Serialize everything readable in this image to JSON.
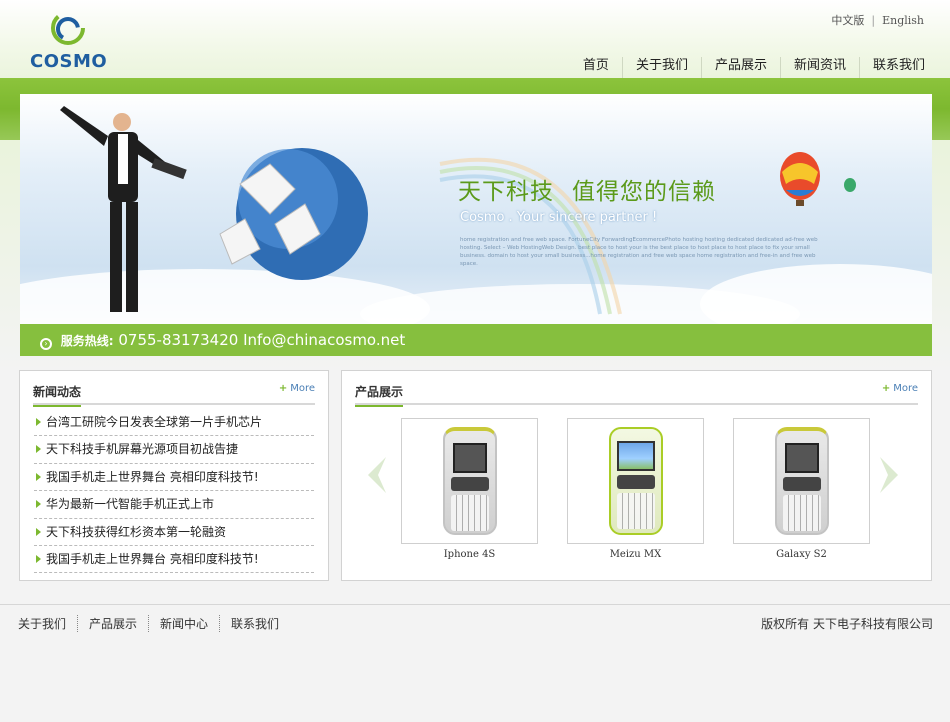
{
  "header": {
    "logo_text": "COSMO",
    "lang": {
      "cn": "中文版",
      "en": "English"
    },
    "nav": [
      "首页",
      "关于我们",
      "产品展示",
      "新闻资讯",
      "联系我们"
    ]
  },
  "banner": {
    "slogan_left": "天下科技",
    "slogan_right": "值得您的信赖",
    "subtitle": "Cosmo . Your sincere partner !",
    "fine_print": "home registration and free web space. FortuneCity ForwardingEcommercePhoto hosting hosting dedicated dedicated ad-free web hosting. Select – Web HostingWeb Design. best place to host your is the best place to host place to host place to fix your small business. domain to host your small business...home registration and free web space home registration and free-in and free web space.",
    "hotline_label": "服务热线:",
    "hotline_value": "0755-83173420  Info@chinacosmo.net"
  },
  "news": {
    "title": "新闻动态",
    "more": "More",
    "items": [
      "台湾工研院今日发表全球第一片手机芯片",
      "天下科技手机屏幕光源项目初战告捷",
      "我国手机走上世界舞台 亮相印度科技节!",
      "华为最新一代智能手机正式上市",
      "天下科技获得红杉资本第一轮融资",
      "我国手机走上世界舞台 亮相印度科技节!"
    ]
  },
  "products": {
    "title": "产品展示",
    "more": "More",
    "items": [
      {
        "name": "Iphone 4S"
      },
      {
        "name": "Meizu MX"
      },
      {
        "name": "Galaxy S2"
      }
    ]
  },
  "footer": {
    "links": [
      "关于我们",
      "产品展示",
      "新闻中心",
      "联系我们"
    ],
    "copyright": "版权所有 天下电子科技有限公司"
  },
  "colors": {
    "brand_green": "#7cb82f",
    "logo_blue": "#1f5ea0"
  }
}
